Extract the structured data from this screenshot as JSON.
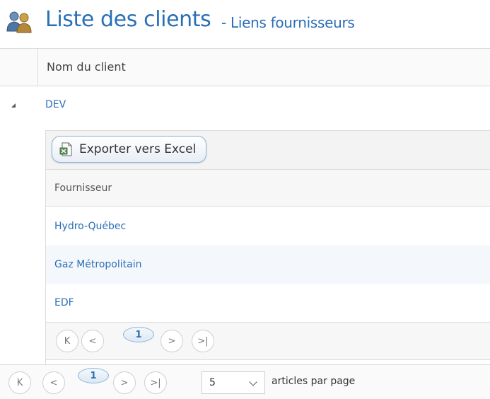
{
  "header": {
    "title": "Liste des clients",
    "subtitle": "- Liens fournisseurs",
    "icon": "users-icon"
  },
  "grid": {
    "column": "Nom du client",
    "group": {
      "label": "DEV",
      "detail": {
        "export_label": "Exporter vers Excel",
        "export_icon": "excel-icon",
        "column": "Fournisseur",
        "rows": [
          "Hydro-Québec",
          "Gaz Métropolitain",
          "EDF"
        ],
        "pager": {
          "first": "K",
          "prev": "<",
          "current": "1",
          "next": ">",
          "last": ">|"
        }
      }
    }
  },
  "pager": {
    "first": "K",
    "prev": "<",
    "current": "1",
    "next": ">",
    "last": ">|",
    "page_size": "5",
    "page_size_label": "articles par page"
  },
  "colors": {
    "accent": "#2a6fb6",
    "border": "#dcdcdc",
    "alt_row": "#f4f8fc"
  }
}
